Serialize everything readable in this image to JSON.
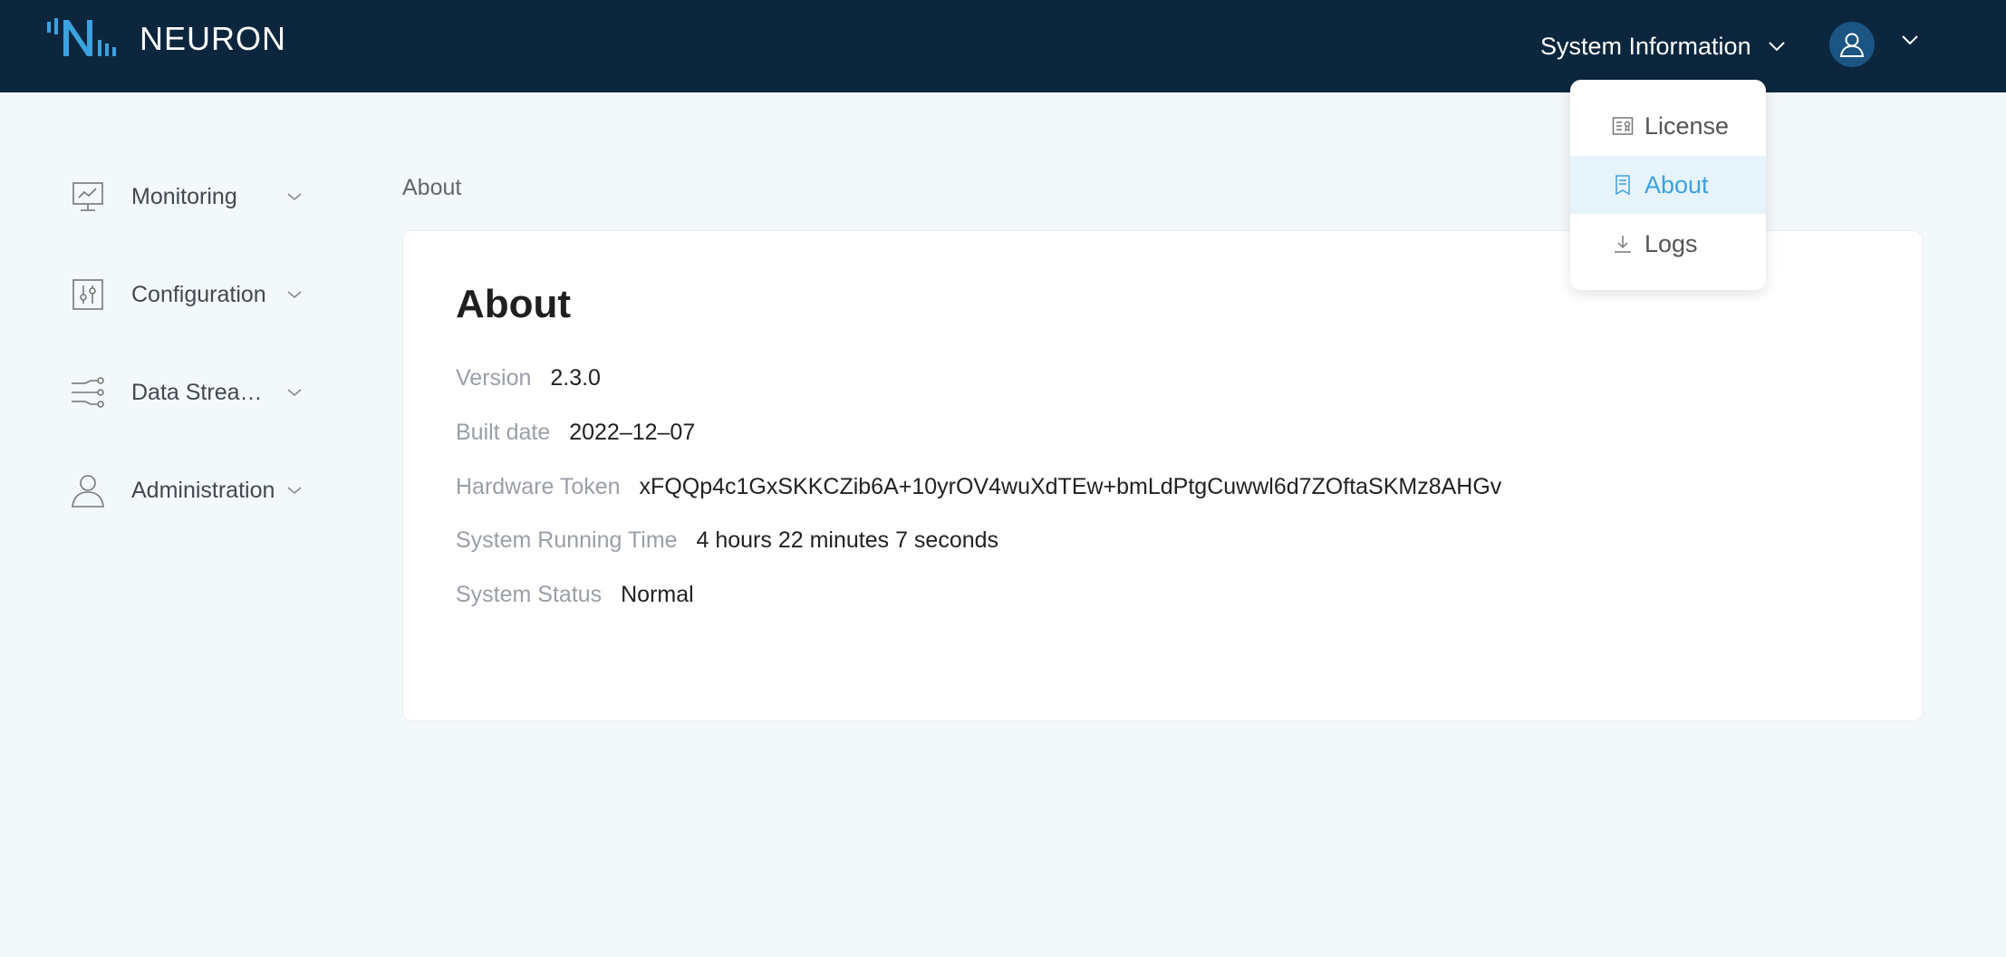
{
  "header": {
    "brand": "NEURON",
    "system_info_label": "System Information"
  },
  "sidebar": {
    "items": [
      {
        "label": "Monitoring",
        "icon": "monitor-chart-icon"
      },
      {
        "label": "Configuration",
        "icon": "sliders-icon"
      },
      {
        "label": "Data Stream Processing",
        "icon": "data-stream-icon"
      },
      {
        "label": "Administration",
        "icon": "user-icon"
      }
    ]
  },
  "breadcrumb": "About",
  "about": {
    "title": "About",
    "rows": [
      {
        "key": "Version",
        "value": "2.3.0"
      },
      {
        "key": "Built date",
        "value": "2022–12–07"
      },
      {
        "key": "Hardware Token",
        "value": "xFQQp4c1GxSKKCZib6A+10yrOV4wuXdTEw+bmLdPtgCuwwl6d7ZOftaSKMz8AHGv"
      },
      {
        "key": "System Running Time",
        "value": "4 hours 22 minutes 7 seconds"
      },
      {
        "key": "System Status",
        "value": "Normal"
      }
    ]
  },
  "dropdown": {
    "items": [
      {
        "label": "License",
        "icon": "license-icon"
      },
      {
        "label": "About",
        "icon": "bookmark-icon",
        "active": true
      },
      {
        "label": "Logs",
        "icon": "download-icon"
      }
    ]
  },
  "colors": {
    "header_bg": "#0c263e",
    "page_bg": "#f3f8fa",
    "accent": "#3ba2e0",
    "avatar_bg": "#1a5584"
  }
}
